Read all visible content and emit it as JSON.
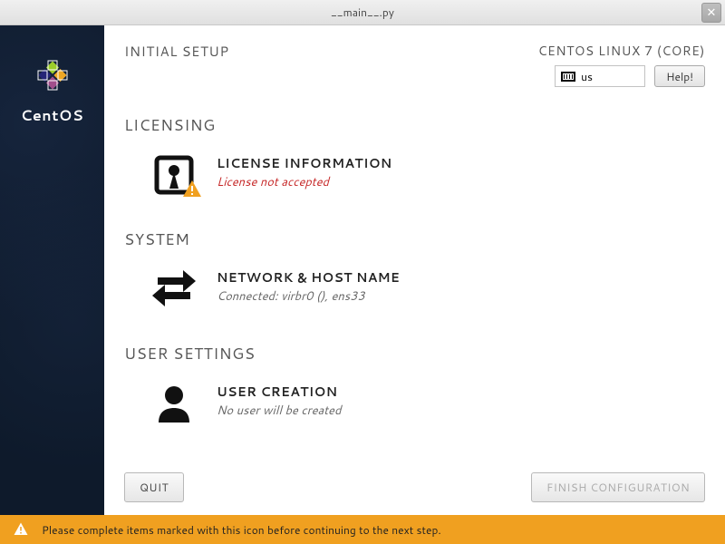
{
  "titlebar": {
    "title": "__main__.py"
  },
  "sidebar": {
    "brand": "CentOS"
  },
  "header": {
    "page_title": "INITIAL SETUP",
    "distro": "CENTOS LINUX 7 (CORE)",
    "keyboard_layout": "us",
    "help_label": "Help!"
  },
  "sections": {
    "licensing": {
      "heading": "LICENSING",
      "spoke": {
        "title": "LICENSE INFORMATION",
        "status": "License not accepted",
        "warning": true
      }
    },
    "system": {
      "heading": "SYSTEM",
      "spoke": {
        "title": "NETWORK & HOST NAME",
        "status": "Connected: virbr0 (), ens33"
      }
    },
    "user": {
      "heading": "USER SETTINGS",
      "spoke": {
        "title": "USER CREATION",
        "status": "No user will be created"
      }
    }
  },
  "footer": {
    "quit_label": "QUIT",
    "finish_label": "FINISH CONFIGURATION"
  },
  "banner": {
    "message": "Please complete items marked with this icon before continuing to the next step."
  }
}
